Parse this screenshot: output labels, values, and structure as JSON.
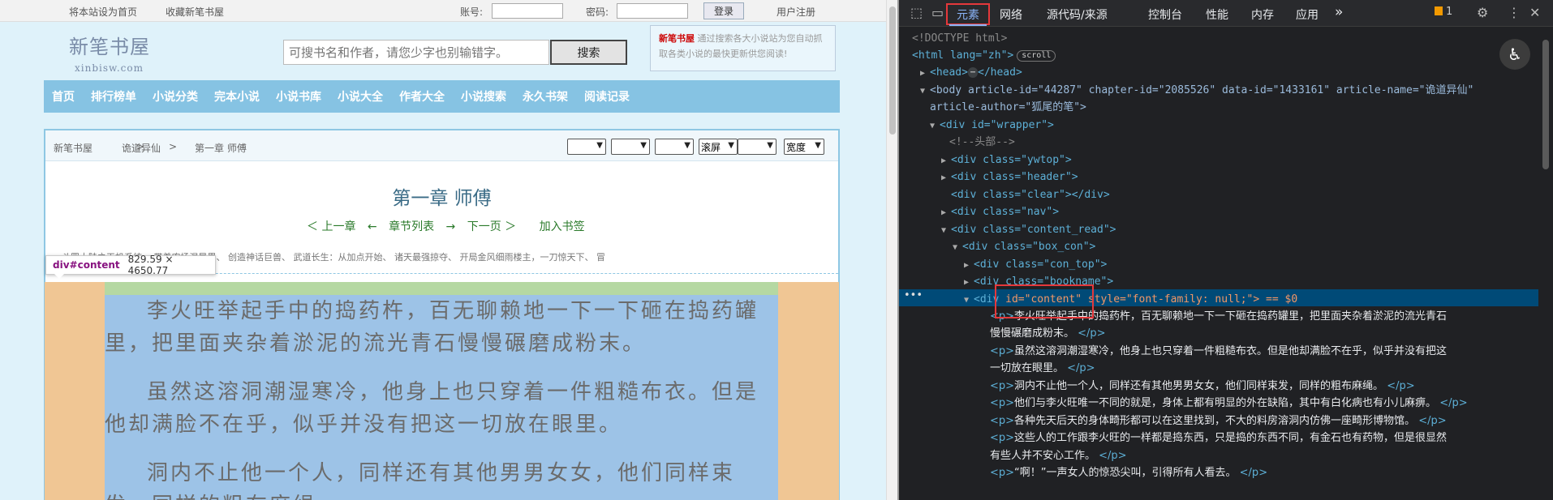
{
  "site": {
    "top_links": [
      "将本站设为首页",
      "收藏新笔书屋"
    ],
    "account_label": "账号:",
    "password_label": "密码:",
    "login_button": "登录",
    "register_link": "用户注册",
    "logo_title": "新笔书屋",
    "logo_sub": "xinbisw.com",
    "search_placeholder": "可搜书名和作者，请您少字也别输错字。",
    "search_button": "搜索",
    "intro_brand": "新笔书屋",
    "intro_text": "通过搜索各大小说站为您自动抓取各类小说的最快更新供您阅读!",
    "nav": [
      "首页",
      "排行榜单",
      "小说分类",
      "完本小说",
      "小说书库",
      "小说大全",
      "作者大全",
      "小说搜索",
      "永久书架",
      "阅读记录"
    ],
    "breadcrumb": [
      "新笔书屋",
      "诡道异仙",
      "第一章 师傅"
    ],
    "breadcrumb_sep": ">",
    "selects": [
      "",
      "",
      "",
      "滚屏",
      "",
      "宽度"
    ],
    "chapter_title": "第一章 师傅",
    "chapter_nav": [
      "＜ 上一章",
      "←",
      "章节列表",
      "→",
      "下一页 ＞",
      "加入书签"
    ],
    "recommend_line": "斗罗大陆之天机系统、 带着农场混异界、 创造神话巨兽、 武道长生：从加点开始、 诸天最强掠夺、 开局金风细雨楼主，一刀惊天下、 冒",
    "tooltip_name": "div#content",
    "tooltip_dims": "829.59 × 4650.77",
    "paragraphs": [
      "李火旺举起手中的捣药杵，百无聊赖地一下一下砸在捣药罐里，把里面夹杂着淤泥的流光青石慢慢碾磨成粉末。",
      "虽然这溶洞潮湿寒冷，他身上也只穿着一件粗糙布衣。但是他却满脸不在乎，似乎并没有把这一切放在眼里。",
      "洞内不止他一个人，同样还有其他男男女女，他们同样束发，同样的粗布麻绳。"
    ]
  },
  "devtools": {
    "tabs": [
      "元素",
      "网络",
      "源代码/来源",
      "控制台",
      "性能",
      "内存",
      "应用"
    ],
    "more_tabs": "»",
    "issues_count": "1",
    "icons": [
      "inspect-icon",
      "device-toolbar-icon",
      "gear-icon",
      "kebab-menu-icon",
      "close-icon",
      "accessibility-icon"
    ],
    "lines": [
      "<!DOCTYPE html>",
      "<html lang=\"zh\">",
      "scroll",
      "<head>",
      "</head>",
      "<body article-id=\"44287\" chapter-id=\"2085526\" data-id=\"1433161\" article-name=\"诡道异仙\"",
      "article-author=\"狐尾的笔\">",
      "<div id=\"wrapper\">",
      "<!--头部-->",
      "<div class=\"ywtop\">",
      "<div class=\"header\">",
      "<div class=\"clear\"></div>",
      "<div class=\"nav\">",
      "<div class=\"content_read\">",
      "<div class=\"box_con\">",
      "<div class=\"con_top\">",
      "<div class=\"bookname\">",
      "id=\"content\" style=\"font-family: null;\"> == $0",
      "李火旺举起手中的捣药杵，百无聊赖地一下一下砸在捣药罐里，把里面夹杂着淤泥的流光青石",
      "慢慢碾磨成粉末。",
      "虽然这溶洞潮湿寒冷，他身上也只穿着一件粗糙布衣。但是他却满脸不在乎，似乎并没有把这",
      "一切放在眼里。",
      "洞内不止他一个人，同样还有其他男男女女，他们同样束发，同样的粗布麻绳。",
      "他们与李火旺唯一不同的就是，身体上都有明显的外在缺陷，其中有白化病也有小儿麻痹。",
      "各种先天后天的身体畸形都可以在这里找到，不大的料房溶洞内仿佛一座畸形博物馆。",
      "这些人的工作跟李火旺的一样都是捣东西，只是捣的东西不同，有金石也有药物，但是很显然",
      "有些人并不安心工作。",
      "“啊！”一声女人的惊恐尖叫，引得所有人看去。"
    ]
  },
  "colors": {
    "nav_bg": "#86c3e3",
    "margin": "#f0c694",
    "padding": "#b5d8a2",
    "content_bg": "#9dc3e7",
    "selected_row": "#004a77",
    "highlight_box": "#e5383b"
  }
}
